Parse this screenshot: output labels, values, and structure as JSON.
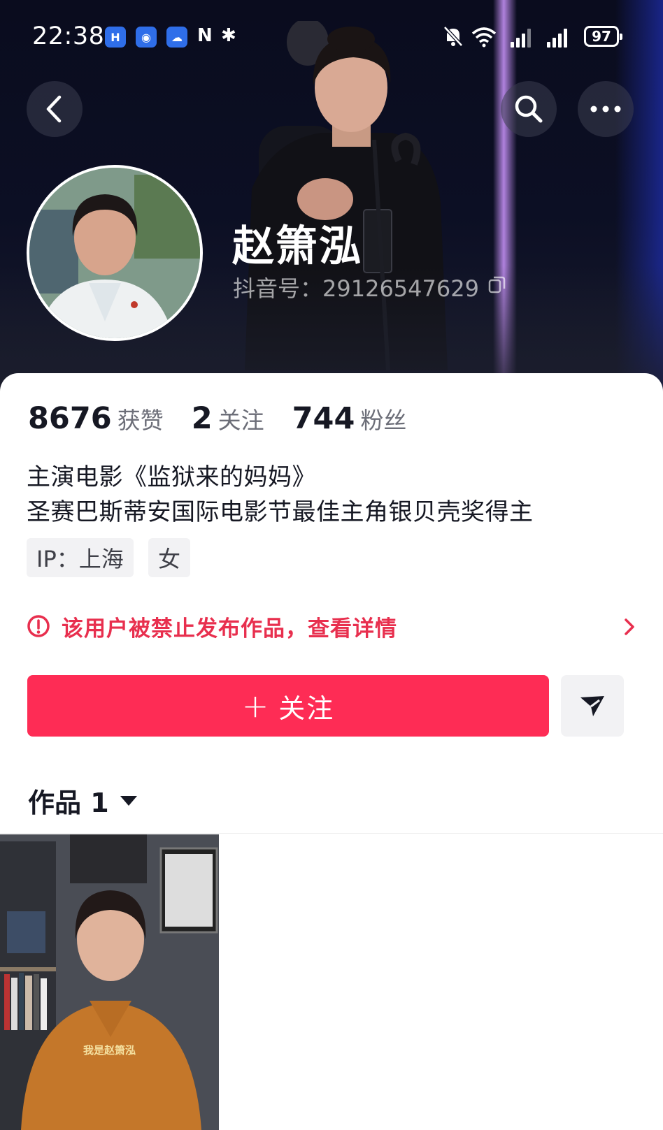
{
  "status_bar": {
    "time": "22:38",
    "battery": "97",
    "app_badges": [
      "H",
      "◉",
      "☁"
    ],
    "nfc_glyph": "N",
    "bluetooth_glyph": "✱"
  },
  "profile": {
    "name": "赵箫泓",
    "douyin_id": "抖音号：29126547629"
  },
  "stats": [
    {
      "value": "8676",
      "label": "获赞"
    },
    {
      "value": "2",
      "label": "关注"
    },
    {
      "value": "744",
      "label": "粉丝"
    }
  ],
  "bio": {
    "line1": "主演电影《监狱来的妈妈》",
    "line2": "圣赛巴斯蒂安国际电影节最佳主角银贝壳奖得主"
  },
  "tags": {
    "ip": "IP：上海",
    "gender": "女"
  },
  "ban_notice": "该用户被禁止发布作品，查看详情",
  "actions": {
    "follow_plus": "+",
    "follow_label": "关注"
  },
  "works": {
    "label": "作品 1"
  },
  "thumbnail": {
    "caption": "我是赵箫泓"
  },
  "colors": {
    "accent": "#fe2c55",
    "warning": "#e82f4e",
    "header_bg": "#0c0f24"
  }
}
